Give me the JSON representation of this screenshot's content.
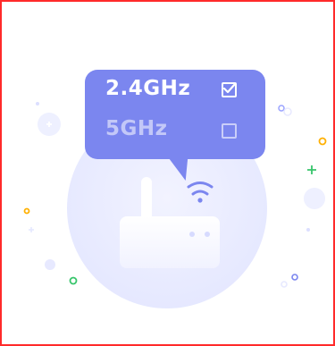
{
  "options": [
    {
      "label": "2.4GHz",
      "checked": true
    },
    {
      "label": "5GHz",
      "checked": false
    }
  ],
  "colors": {
    "border": "#ff2a2a",
    "bubble": "#7b86ef",
    "circle": "#e7e9ff",
    "router": "#ffffff",
    "wifi": "#7b86ef",
    "accent_orange": "#ffb000",
    "accent_green": "#37c56b"
  },
  "icons": [
    "check-icon",
    "empty-checkbox-icon",
    "wifi-icon",
    "router-icon",
    "plus-icon"
  ]
}
